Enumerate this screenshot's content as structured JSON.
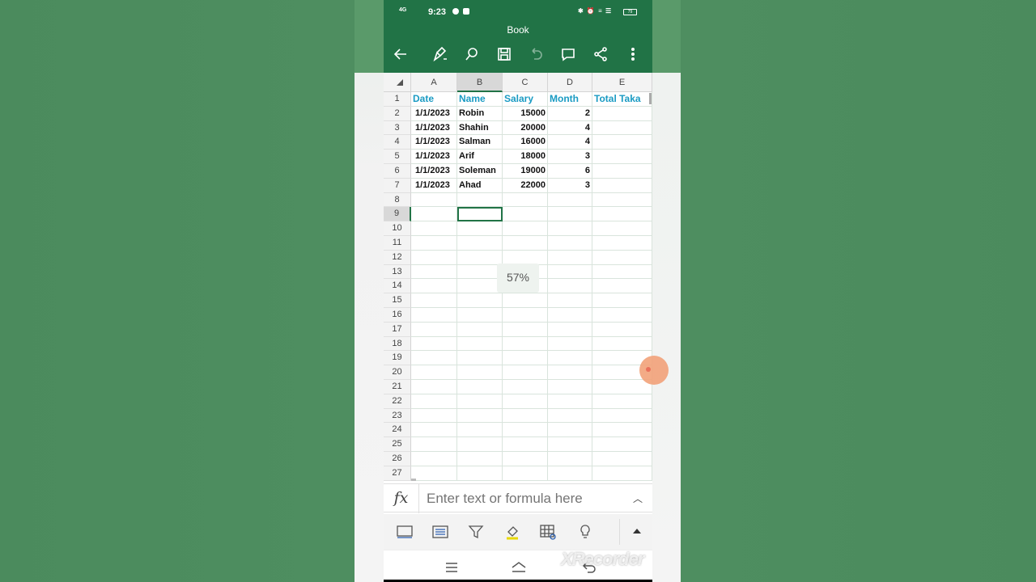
{
  "status": {
    "time": "9:23",
    "network": "4G",
    "battery": "79"
  },
  "document": {
    "title": "Book"
  },
  "columns": [
    "A",
    "B",
    "C",
    "D",
    "E"
  ],
  "rows": [
    "1",
    "2",
    "3",
    "4",
    "5",
    "6",
    "7",
    "8",
    "9",
    "10",
    "11",
    "12",
    "13",
    "14",
    "15",
    "16",
    "17",
    "18",
    "19",
    "20",
    "21",
    "22",
    "23",
    "24",
    "25",
    "26",
    "27"
  ],
  "headers": {
    "date": "Date",
    "name": "Name",
    "salary": "Salary",
    "month": "Month",
    "total": "Total Taka"
  },
  "records": [
    {
      "date": "1/1/2023",
      "name": "Robin",
      "salary": "15000",
      "month": "2"
    },
    {
      "date": "1/1/2023",
      "name": "Shahin",
      "salary": "20000",
      "month": "4"
    },
    {
      "date": "1/1/2023",
      "name": "Salman",
      "salary": "16000",
      "month": "4"
    },
    {
      "date": "1/1/2023",
      "name": "Arif",
      "salary": "18000",
      "month": "3"
    },
    {
      "date": "1/1/2023",
      "name": "Soleman",
      "salary": "19000",
      "month": "6"
    },
    {
      "date": "1/1/2023",
      "name": "Ahad",
      "salary": "22000",
      "month": "3"
    }
  ],
  "selection": {
    "cell": "B9"
  },
  "zoom": "57%",
  "formula": {
    "placeholder": "Enter text or formula here",
    "fx": "fx"
  },
  "watermark": "XRecorder",
  "colors": {
    "excel_green": "#217346",
    "header_text": "#1a9bc3"
  }
}
